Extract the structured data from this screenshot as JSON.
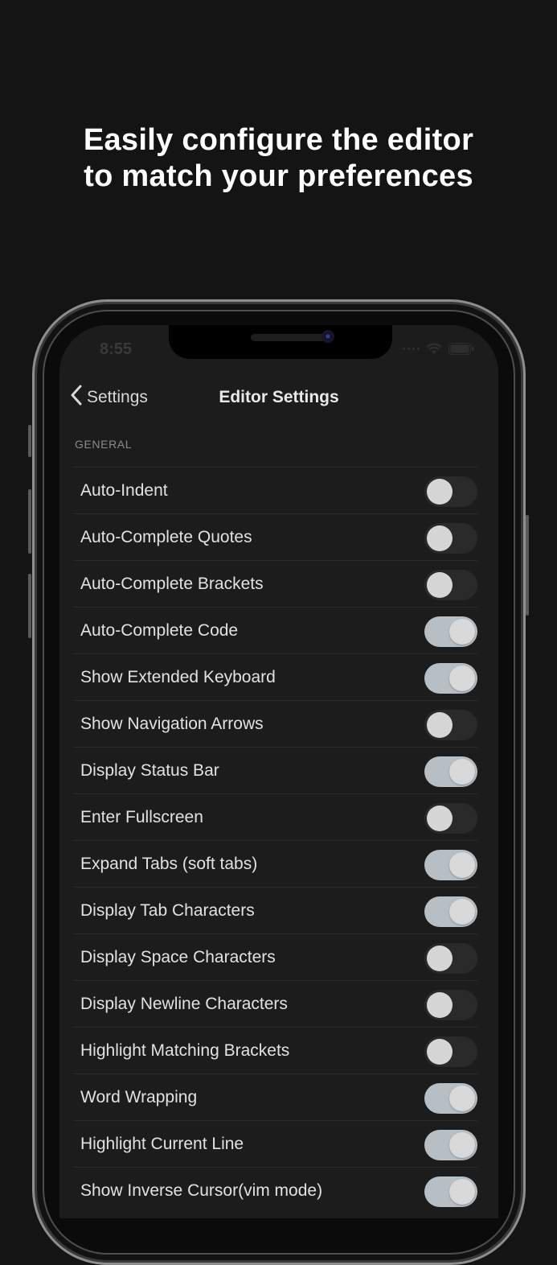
{
  "headline": {
    "line1": "Easily configure the editor",
    "line2": "to match your preferences"
  },
  "status_bar": {
    "time": "8:55"
  },
  "nav": {
    "back_label": "Settings",
    "title": "Editor Settings"
  },
  "section": {
    "header": "GENERAL"
  },
  "settings": [
    {
      "label": "Auto-Indent",
      "on": false
    },
    {
      "label": "Auto-Complete Quotes",
      "on": false
    },
    {
      "label": "Auto-Complete Brackets",
      "on": false
    },
    {
      "label": "Auto-Complete Code",
      "on": true
    },
    {
      "label": "Show Extended Keyboard",
      "on": true
    },
    {
      "label": "Show Navigation Arrows",
      "on": false
    },
    {
      "label": "Display Status Bar",
      "on": true
    },
    {
      "label": "Enter Fullscreen",
      "on": false
    },
    {
      "label": "Expand Tabs (soft tabs)",
      "on": true
    },
    {
      "label": "Display Tab Characters",
      "on": true
    },
    {
      "label": "Display Space Characters",
      "on": false
    },
    {
      "label": "Display Newline Characters",
      "on": false
    },
    {
      "label": "Highlight Matching Brackets",
      "on": false
    },
    {
      "label": "Word Wrapping",
      "on": true
    },
    {
      "label": "Highlight Current Line",
      "on": true
    },
    {
      "label": "Show Inverse Cursor(vim mode)",
      "on": true
    }
  ],
  "colors": {
    "background": "#141414",
    "screen": "#1c1c1c",
    "toggle_on": "#b7bec4",
    "toggle_off": "#2a2a2a"
  }
}
